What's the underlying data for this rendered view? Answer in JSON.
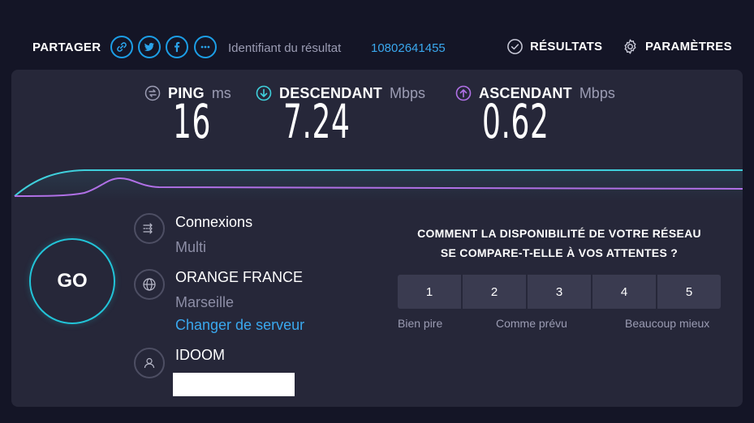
{
  "header": {
    "share_label": "PARTAGER",
    "share_icons": [
      "link-icon",
      "twitter-icon",
      "facebook-icon",
      "more-icon"
    ],
    "result_id_label": "Identifiant du résultat",
    "result_id_value": "10802641455",
    "results_label": "RÉSULTATS",
    "settings_label": "PARAMÈTRES"
  },
  "metrics": {
    "ping": {
      "name": "PING",
      "unit": "ms",
      "value": "16"
    },
    "download": {
      "name": "DESCENDANT",
      "unit": "Mbps",
      "value": "7.24"
    },
    "upload": {
      "name": "ASCENDANT",
      "unit": "Mbps",
      "value": "0.62"
    }
  },
  "go_label": "GO",
  "connections": {
    "title": "Connexions",
    "value": "Multi"
  },
  "server": {
    "name": "ORANGE FRANCE",
    "location": "Marseille",
    "change_link": "Changer de serveur"
  },
  "provider": {
    "name": "IDOOM"
  },
  "survey": {
    "question_line1": "COMMENT LA DISPONIBILITÉ DE VOTRE RÉSEAU",
    "question_line2": "SE COMPARE-T-ELLE À VOS ATTENTES ?",
    "options": [
      "1",
      "2",
      "3",
      "4",
      "5"
    ],
    "label_low": "Bien pire",
    "label_mid": "Comme prévu",
    "label_high": "Beaucoup mieux"
  },
  "colors": {
    "accent": "#1c9ee6",
    "download": "#3fd0dc",
    "upload": "#b070e6",
    "panel": "#262739",
    "background": "#141526"
  }
}
